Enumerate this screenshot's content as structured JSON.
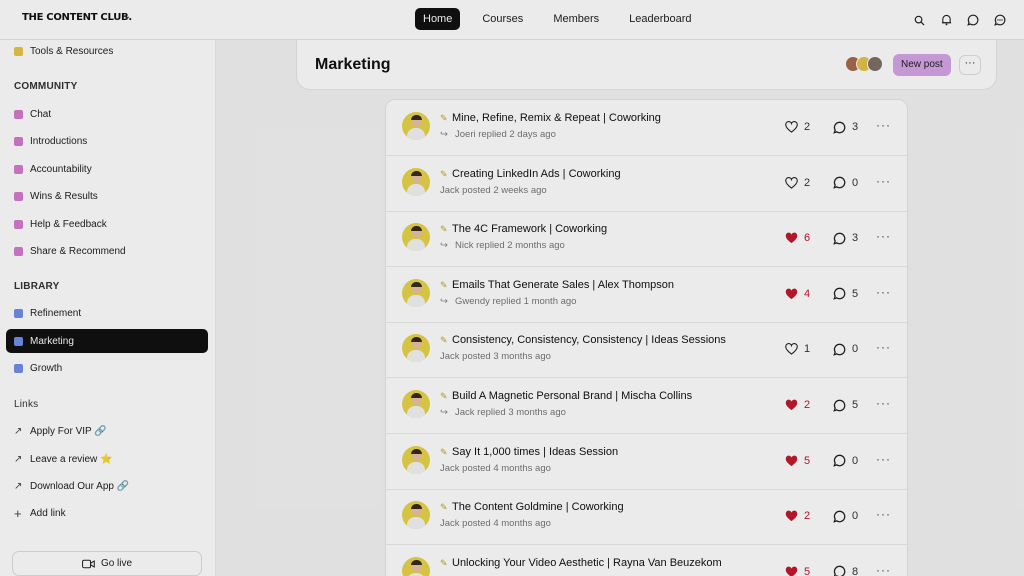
{
  "brand": {
    "logo_text": "THE CONTENT CLUB."
  },
  "header": {
    "nav": [
      "Home",
      "Courses",
      "Members",
      "Leaderboard"
    ],
    "icons": [
      "search-icon",
      "bell-icon",
      "chat-icon",
      "messages-icon"
    ]
  },
  "sidebar": {
    "top_item": "Tools & Resources",
    "community_heading": "COMMUNITY",
    "community": [
      "Chat",
      "Introductions",
      "Accountability",
      "Wins & Results",
      "Help & Feedback",
      "Share & Recommend"
    ],
    "library_heading": "LIBRARY",
    "library": [
      "Refinement",
      "Marketing",
      "Growth"
    ],
    "links_heading": "Links",
    "links": [
      "Apply For VIP 🔗",
      "Leave a review ⭐",
      "Download Our App 🔗",
      "Add link"
    ],
    "go_live": "Go live"
  },
  "page": {
    "title": "Marketing",
    "new_post": "New post",
    "more": "···"
  },
  "posts": [
    {
      "title": "Mine, Refine, Remix & Repeat | Coworking",
      "meta": "Joeri replied 2 days ago",
      "reply": true,
      "likes": "2",
      "liked": false,
      "comments": "3"
    },
    {
      "title": "Creating LinkedIn Ads | Coworking",
      "meta": "Jack posted 2 weeks ago",
      "reply": false,
      "likes": "2",
      "liked": false,
      "comments": "0"
    },
    {
      "title": "The 4C Framework | Coworking",
      "meta": "Nick replied 2 months ago",
      "reply": true,
      "likes": "6",
      "liked": true,
      "comments": "3"
    },
    {
      "title": "Emails That Generate Sales | Alex Thompson",
      "meta": "Gwendy replied 1 month ago",
      "reply": true,
      "likes": "4",
      "liked": true,
      "comments": "5"
    },
    {
      "title": "Consistency, Consistency, Consistency | Ideas Sessions",
      "meta": "Jack posted 3 months ago",
      "reply": false,
      "likes": "1",
      "liked": false,
      "comments": "0"
    },
    {
      "title": "Build A Magnetic Personal Brand | Mischa Collins",
      "meta": "Jack replied 3 months ago",
      "reply": true,
      "likes": "2",
      "liked": true,
      "comments": "5"
    },
    {
      "title": "Say It 1,000 times | Ideas Session",
      "meta": "Jack posted 4 months ago",
      "reply": false,
      "likes": "5",
      "liked": true,
      "comments": "0"
    },
    {
      "title": "The Content Goldmine | Coworking",
      "meta": "Jack posted 4 months ago",
      "reply": false,
      "likes": "2",
      "liked": true,
      "comments": "0"
    },
    {
      "title": "Unlocking Your Video Aesthetic | Rayna Van Beuzekom",
      "meta": "",
      "reply": false,
      "likes": "5",
      "liked": true,
      "comments": "8"
    }
  ],
  "colors": {
    "accent": "#d6a4e6",
    "liked": "#c01a2c",
    "active": "#111111"
  }
}
